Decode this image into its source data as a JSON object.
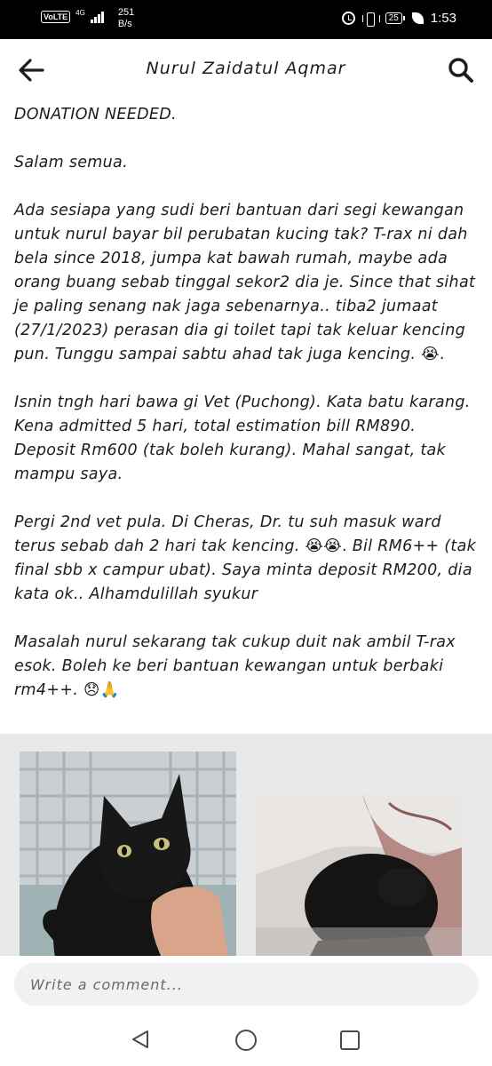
{
  "status_bar": {
    "network_badge": "VoLTE",
    "network_type": "4G",
    "speed_value": "251",
    "speed_unit": "B/s",
    "battery_level": "25",
    "time": "1:53"
  },
  "header": {
    "title": "Nurul Zaidatul Aqmar",
    "back_icon": "arrow-left-icon",
    "search_icon": "search-icon"
  },
  "post": {
    "heading": "DONATION NEEDED.",
    "greeting": "Salam semua.",
    "p1": "Ada sesiapa yang sudi beri bantuan dari segi kewangan untuk nurul bayar bil perubatan kucing tak? T-rax ni dah bela since 2018, jumpa kat bawah rumah, maybe ada orang buang sebab tinggal sekor2 dia je. Since that sihat je paling senang nak jaga sebenarnya.. tiba2 jumaat (27/1/2023) perasan dia gi toilet tapi tak keluar kencing pun. Tunggu sampai sabtu ahad tak juga kencing.",
    "p1_emoji": "😭.",
    "p2": "Isnin tngh hari bawa gi Vet (Puchong). Kata batu karang. Kena admitted 5 hari, total estimation bill RM890. Deposit Rm600 (tak boleh kurang). Mahal sangat, tak mampu saya.",
    "p3_a": "Pergi 2nd vet pula. Di Cheras, Dr. tu suh masuk ward terus sebab dah 2 hari tak kencing.",
    "p3_emoji": "😭😭.",
    "p3_b": "Bil RM6++ (tak final sbb x campur ubat). Saya minta deposit RM200, dia kata ok.. Alhamdulillah syukur",
    "p4": "Masalah nurul sekarang tak cukup duit nak ambil T-rax esok. Boleh ke beri bantuan kewangan untuk berbaki rm4++.",
    "p4_emoji": "😞🙏"
  },
  "photos": [
    {
      "subject": "black cat in basket"
    },
    {
      "subject": "black cat curled up"
    }
  ],
  "comment": {
    "placeholder": "Write a comment..."
  },
  "nav": {
    "back_icon": "triangle-back-icon",
    "home_icon": "circle-home-icon",
    "recents_icon": "square-recents-icon"
  }
}
